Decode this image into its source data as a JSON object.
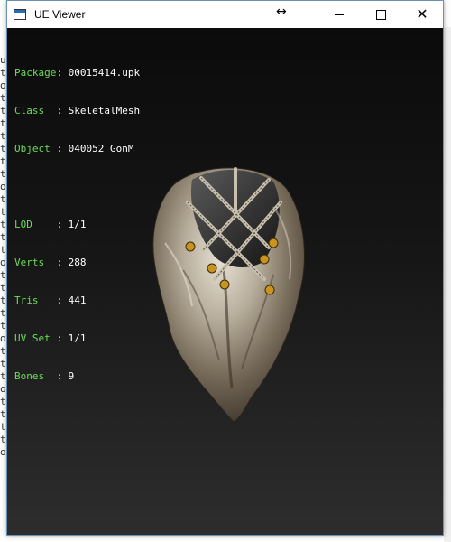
{
  "window": {
    "title": "UE Viewer"
  },
  "mesh_info": [
    {
      "label": "Package",
      "sep": ": ",
      "value": "00015414.upk"
    },
    {
      "label": "Class  ",
      "sep": ": ",
      "value": "SkeletalMesh"
    },
    {
      "label": "Object ",
      "sep": ": ",
      "value": "040052_GonM"
    }
  ],
  "mesh_stats": [
    {
      "label": "LOD    ",
      "sep": ": ",
      "value": "1/1"
    },
    {
      "label": "Verts  ",
      "sep": ": ",
      "value": "288"
    },
    {
      "label": "Tris   ",
      "sep": ": ",
      "value": "441"
    },
    {
      "label": "UV Set ",
      "sep": ": ",
      "value": "1/1"
    },
    {
      "label": "Bones  ",
      "sep": ": ",
      "value": "9"
    }
  ],
  "background_console": {
    "left_column": [
      "u",
      "t",
      "o",
      "t",
      "t",
      "t",
      "t",
      "t",
      "t",
      "t",
      "o",
      "t",
      "t",
      "t",
      "t",
      "t",
      "o",
      "t",
      "t",
      "t",
      "t",
      "t",
      "o",
      "t",
      "t",
      "t",
      "o",
      "t",
      "t",
      "t",
      "t",
      "o"
    ]
  },
  "colors": {
    "label_green": "#6bdc5a",
    "value_white": "#ffffff",
    "viewport_top": "#0b0b0b",
    "viewport_bottom": "#2d2d2d"
  },
  "icons": [
    "app-window-icon",
    "resize-arrows-icon",
    "minimize-icon",
    "maximize-icon",
    "close-icon"
  ]
}
